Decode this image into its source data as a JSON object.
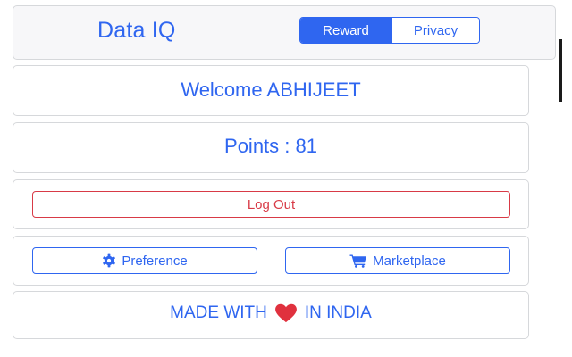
{
  "header": {
    "brand": "Data IQ",
    "tabs": [
      {
        "label": "Reward",
        "active": true
      },
      {
        "label": "Privacy",
        "active": false
      }
    ]
  },
  "welcome": {
    "text": "Welcome ABHIJEET"
  },
  "points": {
    "text": "Points : 81"
  },
  "logout": {
    "label": "Log Out"
  },
  "actions": {
    "preference_label": "Preference",
    "preference_icon": "gear-icon",
    "marketplace_label": "Marketplace",
    "marketplace_icon": "cart-icon"
  },
  "footer": {
    "prefix": "MADE WITH",
    "icon": "heart-icon",
    "suffix": "IN INDIA"
  },
  "colors": {
    "primary": "#2f66f0",
    "danger": "#d83a46",
    "heart": "#e0313e",
    "header_bg": "#f7f7f9",
    "border": "#d6d8db"
  }
}
